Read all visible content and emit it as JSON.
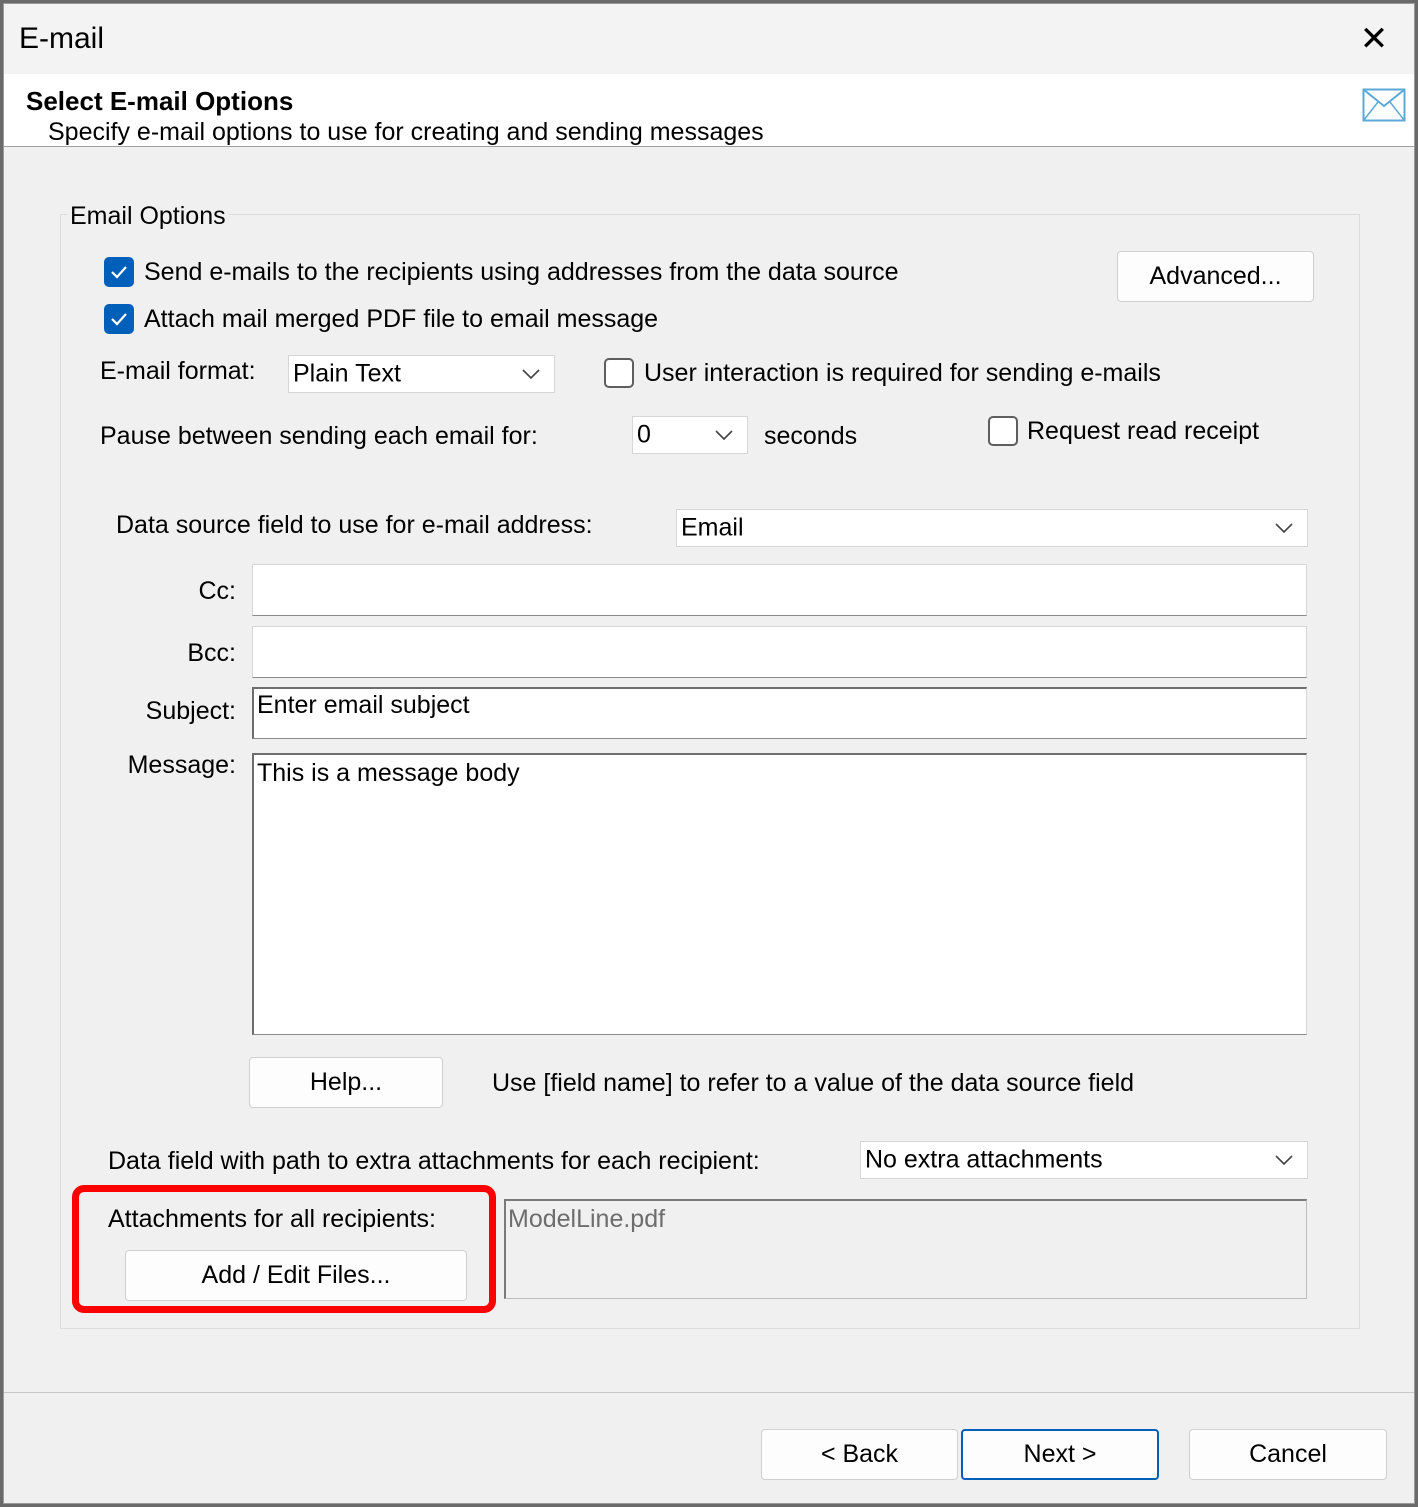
{
  "window": {
    "title": "E-mail",
    "close_label": "✕"
  },
  "header": {
    "title": "Select E-mail Options",
    "subtitle": "Specify e-mail options to use for creating and sending messages",
    "icon": "envelope-icon"
  },
  "group": {
    "label": "Email Options",
    "send_checkbox": {
      "label": "Send e-mails to the recipients using addresses from the data source",
      "checked": true
    },
    "attach_checkbox": {
      "label": "Attach mail merged PDF file to email message",
      "checked": true
    },
    "advanced_button": "Advanced...",
    "format": {
      "label": "E-mail format:",
      "value": "Plain Text"
    },
    "user_interaction_checkbox": {
      "label": "User interaction is required for sending e-mails",
      "checked": false
    },
    "pause": {
      "label": "Pause between sending each email for:",
      "value": "0",
      "unit": "seconds"
    },
    "read_receipt_checkbox": {
      "label": "Request read receipt",
      "checked": false
    },
    "address_field": {
      "label": "Data source field to use for e-mail address:",
      "value": "Email"
    },
    "cc": {
      "label": "Cc:",
      "value": ""
    },
    "bcc": {
      "label": "Bcc:",
      "value": ""
    },
    "subject": {
      "label": "Subject:",
      "value": "Enter email subject"
    },
    "message": {
      "label": "Message:",
      "value": "This is a message body"
    },
    "help_button": "Help...",
    "help_hint": "Use [field name] to refer to a value of the data source field",
    "extra_attachments": {
      "label": "Data field with path to extra attachments for each recipient:",
      "value": "No extra attachments"
    },
    "all_attachments": {
      "label": "Attachments for all recipients:",
      "button": "Add / Edit Files...",
      "files": "ModelLine.pdf"
    }
  },
  "footer": {
    "back": "< Back",
    "next": "Next >",
    "cancel": "Cancel"
  },
  "colors": {
    "accent": "#005fb8",
    "highlight": "#ff0000"
  }
}
